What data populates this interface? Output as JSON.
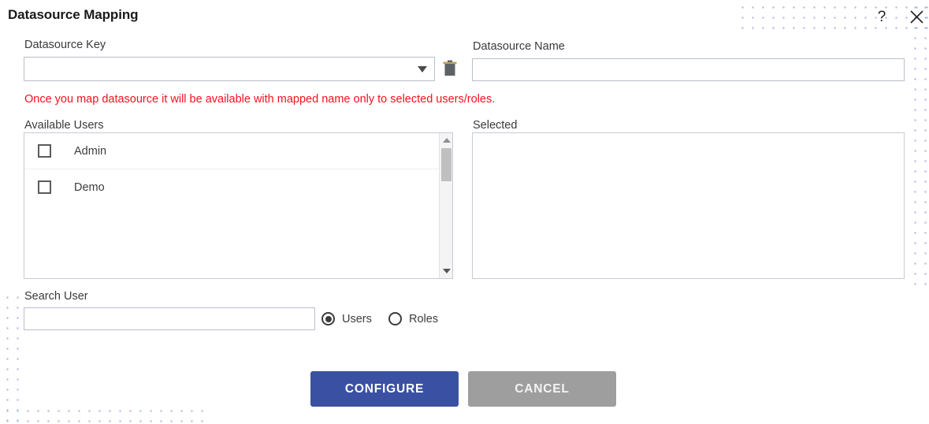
{
  "dialog": {
    "title": "Datasource Mapping",
    "help_icon": "question-mark-icon",
    "close_icon": "close-x-icon"
  },
  "datasource_key": {
    "label": "Datasource Key",
    "value": "",
    "caret_icon": "chevron-down-icon",
    "delete_icon": "trash-icon"
  },
  "datasource_name": {
    "label": "Datasource Name",
    "value": "",
    "placeholder": ""
  },
  "warning": {
    "text": "Once you map datasource it will be available with mapped name only to selected users/roles.",
    "color": "#fa0f1e"
  },
  "available_users": {
    "label": "Available Users",
    "rows": [
      {
        "label": "Admin",
        "checked": false
      },
      {
        "label": "Demo",
        "checked": false
      }
    ],
    "scrollbar": {
      "up_icon": "arrow-up-icon",
      "down_icon": "arrow-down-icon"
    }
  },
  "selected": {
    "label": "Selected",
    "rows": []
  },
  "search": {
    "label": "Search User",
    "value": "",
    "placeholder": ""
  },
  "scope_radio": {
    "users_label": "Users",
    "roles_label": "Roles",
    "selected": "Users"
  },
  "actions": {
    "configure_label": "CONFIGURE",
    "cancel_label": "CANCEL",
    "configure_color": "#3a51a3",
    "cancel_color": "#9e9e9e"
  },
  "decoration": {
    "dot_color": "#a8b2de"
  }
}
